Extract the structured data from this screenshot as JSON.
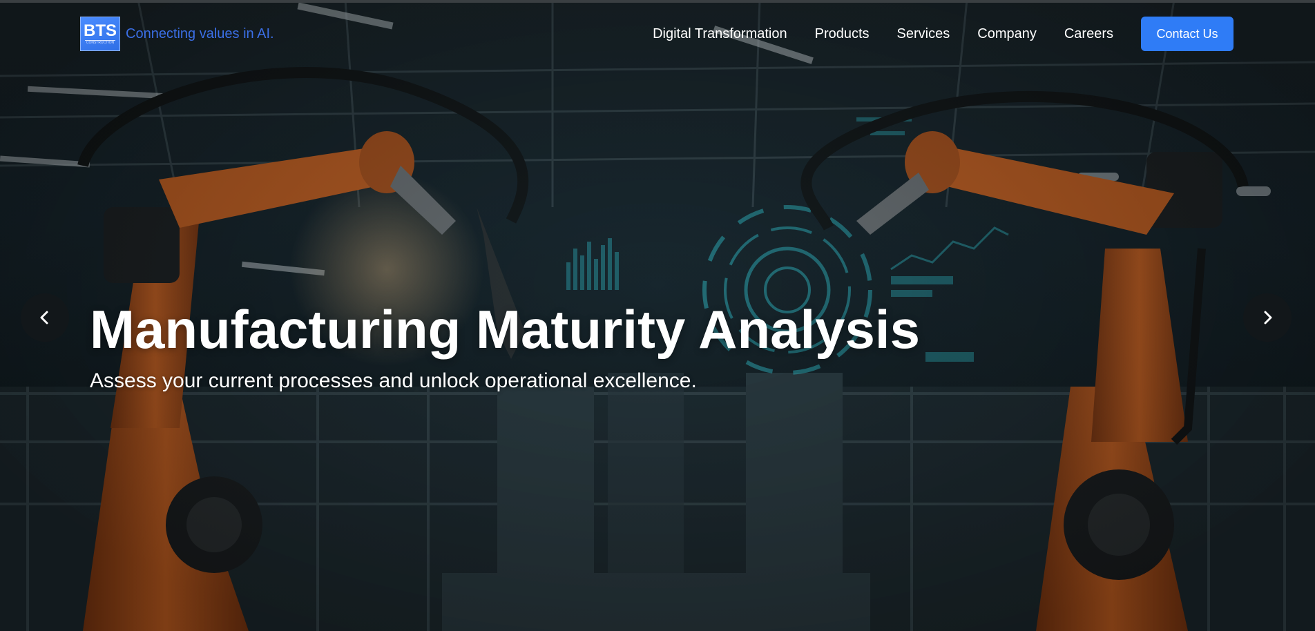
{
  "brand": {
    "logo_text": "BTS",
    "logo_subtext": "CONSTRUCTION",
    "tagline": "Connecting values in AI."
  },
  "nav": {
    "items": [
      {
        "label": "Digital Transformation"
      },
      {
        "label": "Products"
      },
      {
        "label": "Services"
      },
      {
        "label": "Company"
      },
      {
        "label": "Careers"
      }
    ],
    "cta_label": "Contact Us"
  },
  "hero": {
    "title": "Manufacturing Maturity Analysis",
    "subtitle": "Assess your current processes and unlock operational excellence.",
    "prev_icon": "chevron-left-icon",
    "next_icon": "chevron-right-icon"
  },
  "colors": {
    "accent": "#2f7cf6",
    "tagline": "#3b6fe6",
    "robot_orange": "#b5551c",
    "hud_teal": "#2fb8c4"
  }
}
